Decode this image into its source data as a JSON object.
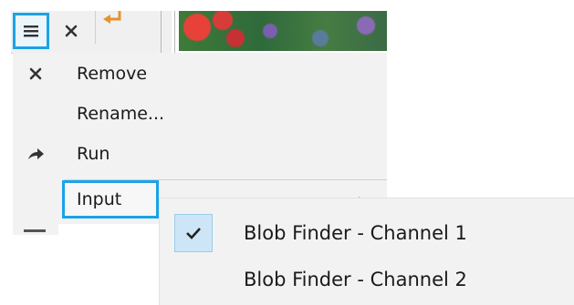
{
  "toolbar": {
    "menu_icon": "hamburger-icon",
    "close_icon": "close-icon",
    "arrow_icon": "return-arrow-icon",
    "highlight_color": "#1aa3e8"
  },
  "context_menu": {
    "items": [
      {
        "label": "Remove",
        "icon": "close-icon"
      },
      {
        "label": "Rename...",
        "icon": ""
      },
      {
        "label": "Run",
        "icon": "share-arrow-icon"
      },
      {
        "label": "Input",
        "icon": "",
        "has_submenu": true
      }
    ]
  },
  "submenu": {
    "items": [
      {
        "label": "Blob Finder - Channel 1",
        "checked": true
      },
      {
        "label": "Blob Finder - Channel 2",
        "checked": false
      }
    ]
  }
}
